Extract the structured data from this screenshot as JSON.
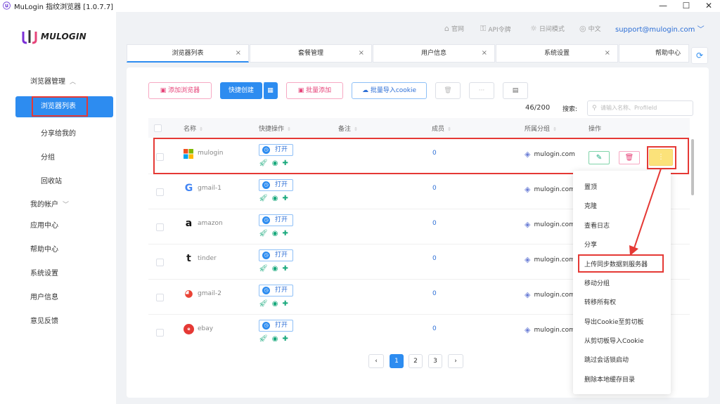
{
  "window": {
    "title": "MuLogin 指纹浏览器 [1.0.7.7]",
    "controls": [
      "—",
      "☐",
      "✕"
    ]
  },
  "brand": {
    "logo_text": "MULOGIN"
  },
  "header": {
    "links": [
      {
        "icon": "home-icon",
        "label": "官网"
      },
      {
        "icon": "key-icon",
        "label": "API令牌"
      },
      {
        "icon": "sun-icon",
        "label": "日间模式"
      },
      {
        "icon": "globe-icon",
        "label": "中文"
      }
    ],
    "account": "support@mulogin.com"
  },
  "sidebar": {
    "section": "浏览器管理",
    "items": [
      {
        "label": "浏览器列表",
        "active": true
      },
      {
        "label": "分享给我的"
      },
      {
        "label": "分组"
      },
      {
        "label": "回收站"
      }
    ],
    "top_items": [
      {
        "label": "我的帐户",
        "expandable": true
      },
      {
        "label": "应用中心"
      },
      {
        "label": "帮助中心"
      },
      {
        "label": "系统设置"
      },
      {
        "label": "用户信息"
      },
      {
        "label": "意见反馈"
      }
    ]
  },
  "tabs": [
    {
      "label": "浏览器列表",
      "active": true
    },
    {
      "label": "套餐管理"
    },
    {
      "label": "用户信息"
    },
    {
      "label": "系统设置"
    },
    {
      "label": "帮助中心"
    }
  ],
  "toolbar": {
    "add_browser": "添加浏览器",
    "quick_create": "快捷创建",
    "batch_add": "批量添加",
    "batch_import_cookie": "批量导入cookie",
    "more": "···"
  },
  "list": {
    "count": "46/200",
    "search_label": "搜索:",
    "search_placeholder": "请输入名称、ProfileId",
    "columns": [
      "名称",
      "快捷操作",
      "备注",
      "成员",
      "所属分组",
      "操作"
    ],
    "open_label": "打开",
    "rows": [
      {
        "icon": "microsoft-icon",
        "name": "mulogin",
        "members": "0",
        "group": "mulogin.com"
      },
      {
        "icon": "google-icon",
        "name": "gmail-1",
        "members": "0",
        "group": "mulogin.com"
      },
      {
        "icon": "amazon-icon",
        "name": "amazon",
        "members": "0",
        "group": "mulogin.com"
      },
      {
        "icon": "tinder-icon",
        "name": "tinder",
        "members": "0",
        "group": "mulogin.com"
      },
      {
        "icon": "chrome-icon",
        "name": "gmail-2",
        "members": "0",
        "group": "mulogin.com"
      },
      {
        "icon": "ebay-icon",
        "name": "ebay",
        "members": "0",
        "group": "mulogin.com"
      }
    ]
  },
  "context_menu": {
    "items": [
      "置顶",
      "克隆",
      "查看日志",
      "分享",
      "上传同步数据到服务器",
      "移动分组",
      "转移所有权",
      "导出Cookie至剪切板",
      "从剪切板导入Cookie",
      "跳过会话锁启动",
      "删除本地缓存目录"
    ],
    "highlighted_index": 4
  },
  "pagination": {
    "prev": "‹",
    "pages": [
      "1",
      "2",
      "3"
    ],
    "current": "1",
    "next": "›"
  },
  "colors": {
    "accent": "#2d8cf0",
    "highlight": "#e53935",
    "pink": "#e6457a",
    "green": "#17a87b"
  }
}
